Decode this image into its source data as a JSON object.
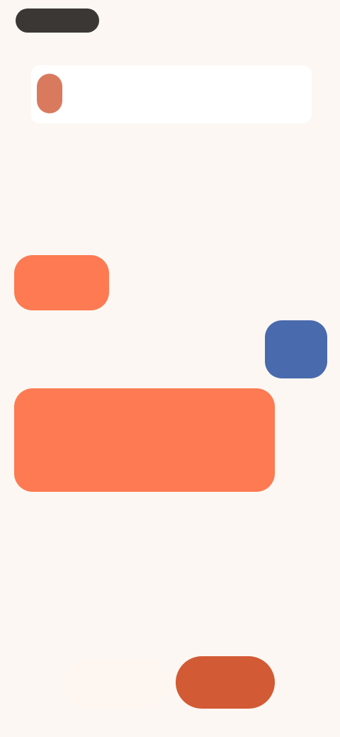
{
  "top_bar": {
    "left_pill_label": "",
    "right_label": ""
  },
  "header_card": {
    "title": "",
    "meta": ""
  },
  "status": {
    "accent_label": "",
    "sub_label": ""
  },
  "section": {
    "label": ""
  },
  "items": {
    "orange_chip_label": "",
    "blue_chip_label": "",
    "orange_block_label": ""
  },
  "actions": {
    "secondary_label": "",
    "primary_label": ""
  },
  "colors": {
    "background": "#fcf7f2",
    "accent_orange": "#fd7a52",
    "accent_blue": "#4a6aae",
    "primary_button": "#d25a34",
    "accent_yellow": "#e8b85a"
  }
}
